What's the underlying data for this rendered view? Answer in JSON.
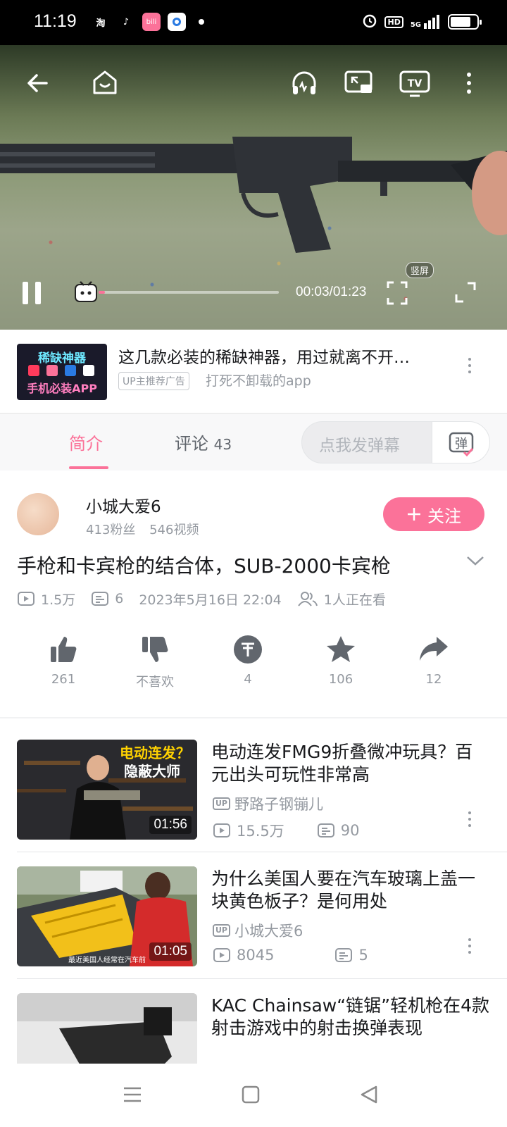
{
  "status_bar": {
    "time": "11:19",
    "apps": [
      "taobao-icon",
      "tiktok-icon",
      "bilibili-icon",
      "browser-icon"
    ],
    "hd": "HD",
    "network": "5G"
  },
  "player": {
    "current_time": "00:03",
    "duration": "01:23",
    "time_display": "00:03/01:23",
    "progress": 0.036,
    "vertical_label": "竖屏"
  },
  "ad": {
    "thumb_line1": "稀缺神器",
    "thumb_line2": "手机必装APP",
    "title": "这几款必装的稀缺神器，用过就离不开…",
    "tag": "UP主推荐广告",
    "subtitle": "打死不卸载的app"
  },
  "tabs": {
    "intro": "简介",
    "comments": "评论",
    "comments_count": "43",
    "danmaku_placeholder": "点我发弹幕",
    "danmaku_button": "弹"
  },
  "uploader": {
    "name": "小城大爱6",
    "fans": "413粉丝",
    "videos": "546视频",
    "follow_label": "关注"
  },
  "video": {
    "title": "手枪和卡宾枪的结合体，SUB-2000卡宾枪",
    "views": "1.5万",
    "danmaku": "6",
    "date": "2023年5月16日 22:04",
    "watching": "1人正在看"
  },
  "actions": [
    {
      "name": "like",
      "label": "261"
    },
    {
      "name": "dislike",
      "label": "不喜欢"
    },
    {
      "name": "coin",
      "label": "4"
    },
    {
      "name": "favorite",
      "label": "106"
    },
    {
      "name": "share",
      "label": "12"
    }
  ],
  "related": [
    {
      "title": "电动连发FMG9折叠微冲玩具？百元出头可玩性非常高",
      "uploader": "野路子钢镚儿",
      "views": "15.5万",
      "danmaku": "90",
      "duration": "01:56",
      "thumb_text": "电动连发？隐蔽大师"
    },
    {
      "title": "为什么美国人要在汽车玻璃上盖一块黄色板子？是何用处",
      "uploader": "小城大爱6",
      "views": "8045",
      "danmaku": "5",
      "duration": "01:05",
      "thumb_text": "最近美国人经常在汽车前"
    },
    {
      "title": "KAC Chainsaw“链锯”轻机枪在4款射击游戏中的射击换弹表现",
      "uploader": "",
      "views": "",
      "danmaku": "",
      "duration": ""
    }
  ],
  "colors": {
    "accent": "#fb7299",
    "muted": "#9499a0",
    "text": "#18191c"
  }
}
